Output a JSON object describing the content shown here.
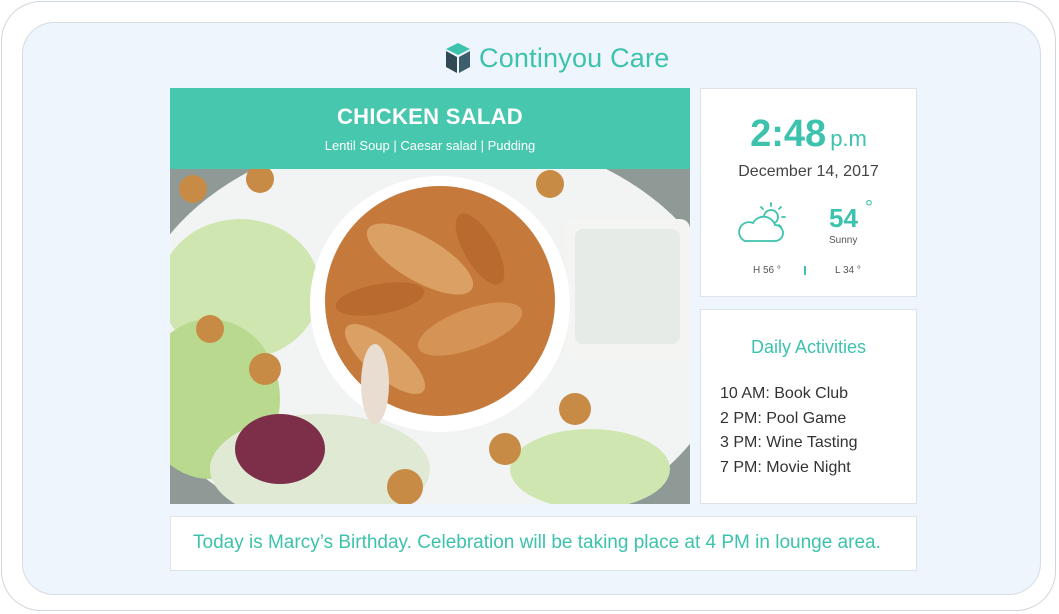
{
  "brand": {
    "name_a": "Continyou",
    "name_b": "Care",
    "accent": "#3cc2ad",
    "icon": "cube-logo-icon"
  },
  "menu": {
    "title": "CHICKEN SALAD",
    "sides": "Lentil Soup | Caesar salad | Pudding",
    "image": "chicken-salad-photo"
  },
  "clock": {
    "time": "2:48",
    "ampm": "p.m",
    "date": "December 14, 2017"
  },
  "weather": {
    "icon": "partly-cloudy-icon",
    "temp": "54",
    "degree": "°",
    "condition": "Sunny",
    "high": "H 56 °",
    "low": "L 34 °"
  },
  "activities": {
    "title": "Daily Activities",
    "items": [
      "10 AM: Book Club",
      "2 PM: Pool Game",
      "3 PM: Wine Tasting",
      "7 PM: Movie Night"
    ]
  },
  "announcement": "Today is Marcy’s Birthday. Celebration will be taking place at 4 PM in lounge area."
}
